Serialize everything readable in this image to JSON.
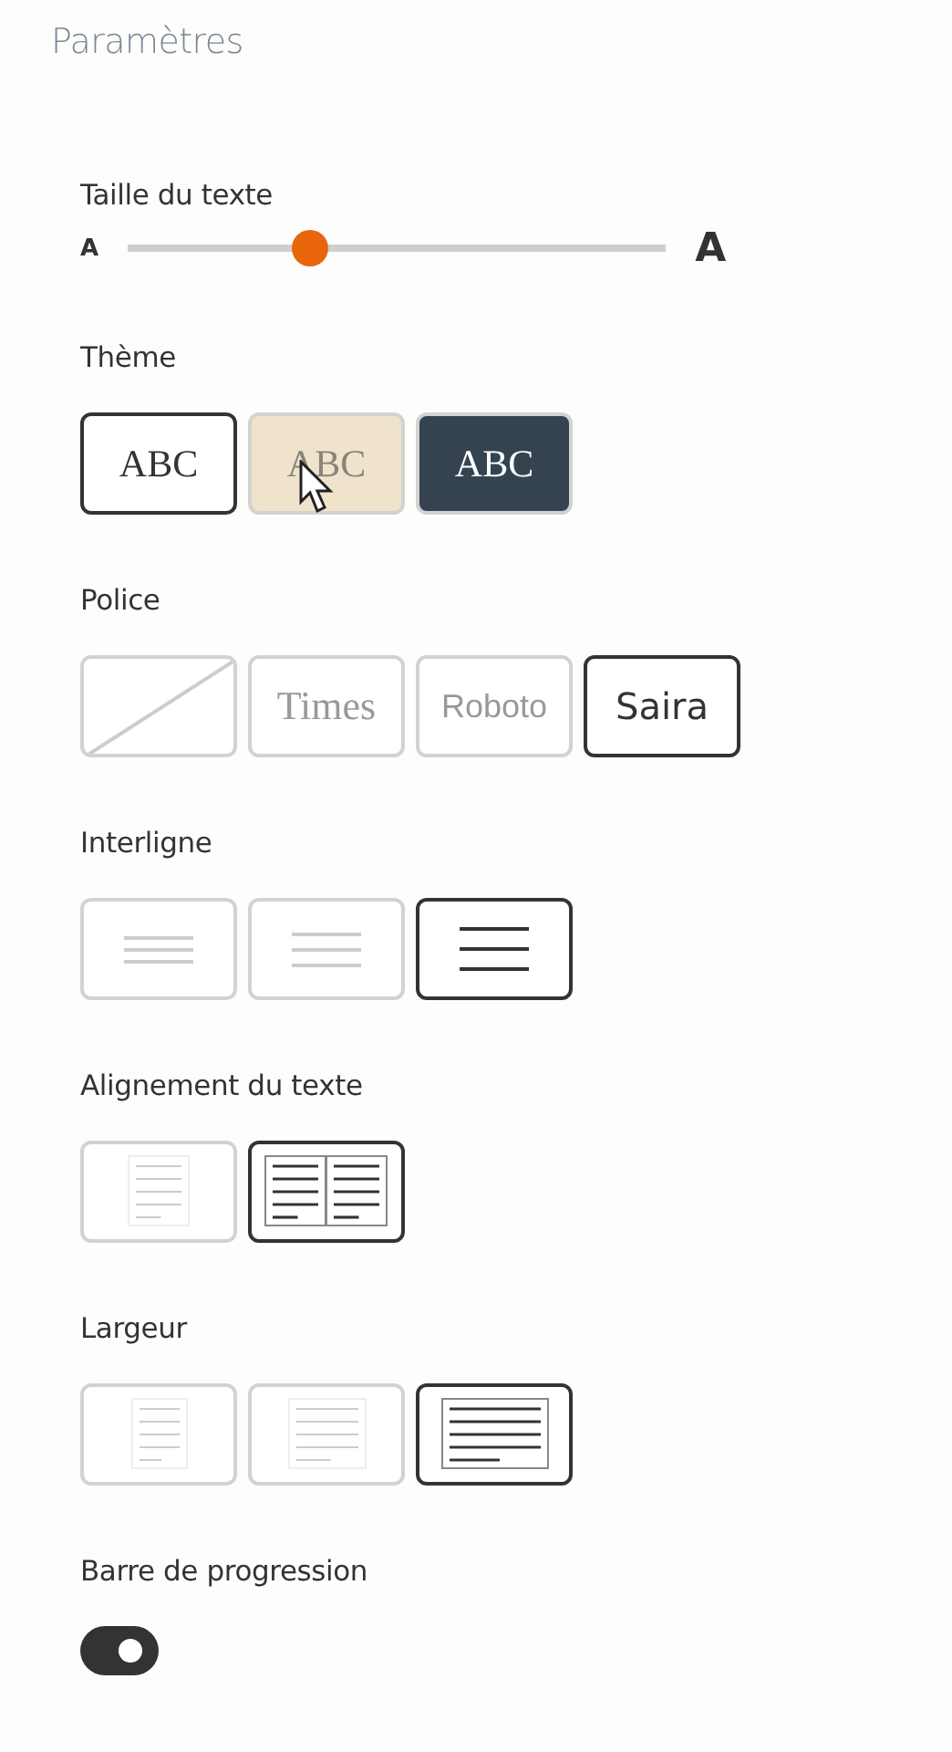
{
  "header": {
    "title": "Paramètres"
  },
  "text_size": {
    "label": "Taille du texte",
    "small_glyph": "A",
    "large_glyph": "A",
    "level": 0.34
  },
  "theme": {
    "label": "Thème",
    "options": [
      {
        "kind": "light",
        "text": "ABC",
        "selected": true
      },
      {
        "kind": "sepia",
        "text": "ABC",
        "selected": false
      },
      {
        "kind": "dark",
        "text": "ABC",
        "selected": false
      }
    ]
  },
  "font": {
    "label": "Police",
    "options": [
      {
        "kind": "none",
        "selected": false
      },
      {
        "kind": "serif",
        "text": "Times",
        "selected": false
      },
      {
        "kind": "sans",
        "text": "Roboto",
        "selected": false
      },
      {
        "kind": "display",
        "text": "Saira",
        "selected": true
      }
    ]
  },
  "line_spacing": {
    "label": "Interligne",
    "options": [
      {
        "kind": "tight",
        "selected": false
      },
      {
        "kind": "normal",
        "selected": false
      },
      {
        "kind": "wide",
        "selected": true
      }
    ]
  },
  "alignment": {
    "label": "Alignement du texte",
    "options": [
      {
        "kind": "left",
        "selected": false
      },
      {
        "kind": "justify",
        "selected": true
      }
    ]
  },
  "width": {
    "label": "Largeur",
    "options": [
      {
        "kind": "narrow",
        "selected": false
      },
      {
        "kind": "medium",
        "selected": false
      },
      {
        "kind": "wide",
        "selected": true
      }
    ]
  },
  "progress_bar": {
    "label": "Barre de progression",
    "on": true
  }
}
